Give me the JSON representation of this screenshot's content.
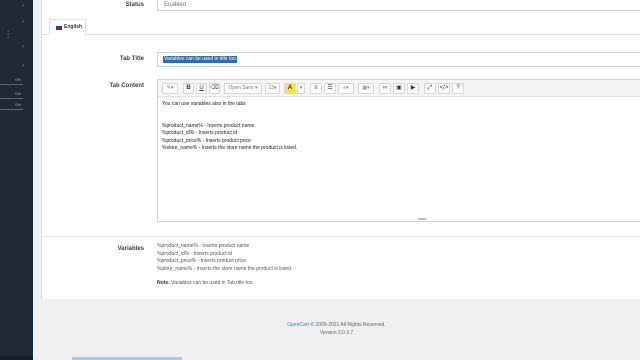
{
  "sidebar": {
    "badges": [
      "0%",
      "0%",
      "0%"
    ]
  },
  "form": {
    "status_label": "Status",
    "status_value": "Enabled",
    "language_tab": "English",
    "tab_title_label": "Tab Title",
    "tab_title_value": "Variables can be used in title too",
    "tab_content_label": "Tab Content",
    "variables_label": "Variables"
  },
  "toolbar": {
    "font_name": "Open Sans",
    "font_size": "13"
  },
  "editor": {
    "intro": "You can use variables also in the tabs",
    "lines": [
      "%product_name% - Inserts product name",
      "%product_id% - Inserts product id",
      "%product_price% - Inserts product price",
      "%store_name% - Inserts the store name the product is listed."
    ]
  },
  "variables": {
    "lines": [
      "%product_name% - Inserts product name",
      "%product_id% - Inserts product id",
      "%product_price% - Inserts product price",
      "%store_name% - Inserts the store name the product is listed."
    ],
    "note_label": "Note:",
    "note_text": " Variables can be used in Tab title too."
  },
  "footer": {
    "brand": "OpenCart",
    "copyright": " © 2009-2021 All Rights Reserved.",
    "version": "Version 3.0.3.7"
  },
  "colors": {
    "sidebar": "#1f2a36",
    "accent_link": "#2f83c5",
    "selection": "#2f6ea8",
    "highlight": "#f6e24a"
  }
}
